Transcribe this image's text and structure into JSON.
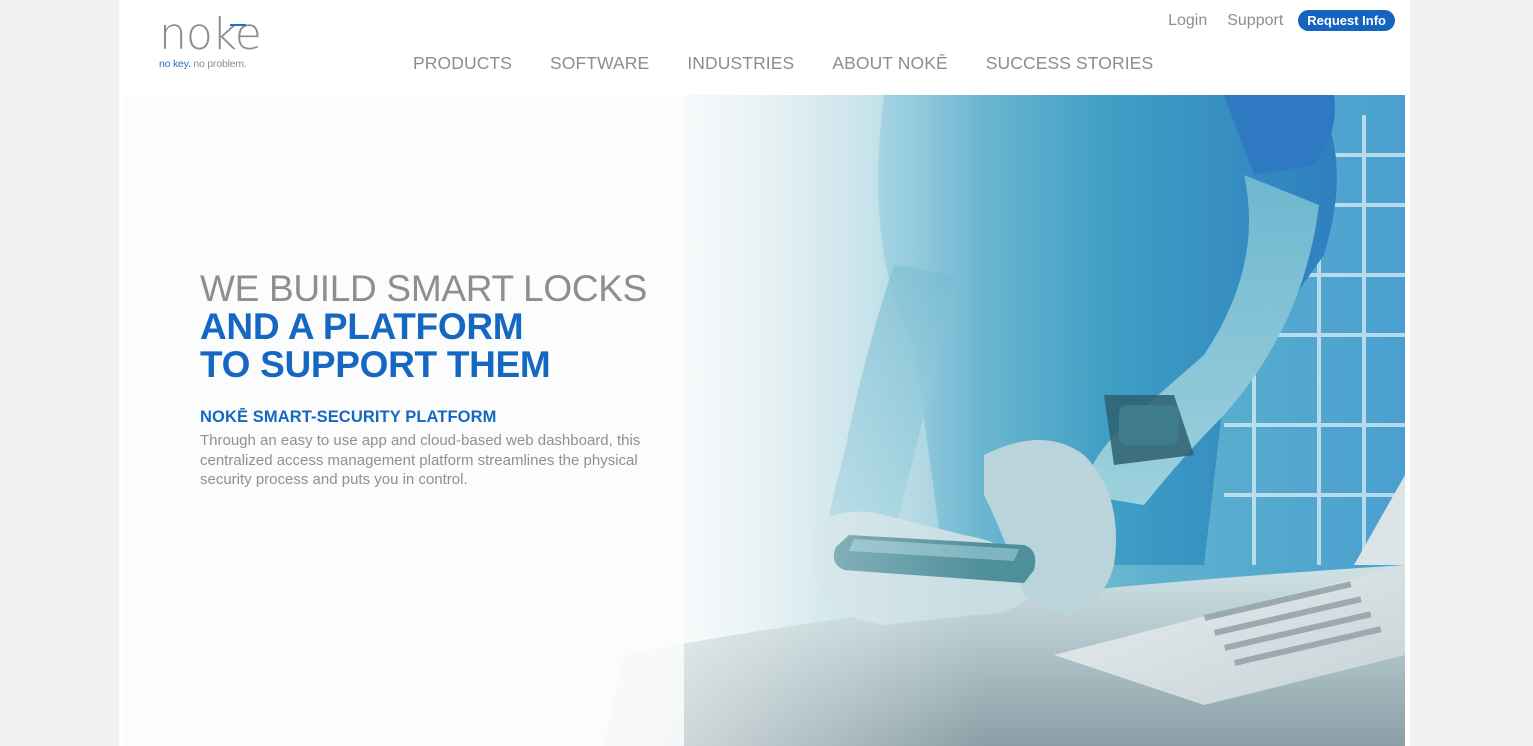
{
  "brand": {
    "logo_word": "nok",
    "logo_e": "e",
    "tagline_part1": "no key.",
    "tagline_part2": " no problem."
  },
  "utility_nav": {
    "login": "Login",
    "support": "Support",
    "request_info": "Request Info"
  },
  "main_nav": {
    "items": [
      "PRODUCTS",
      "SOFTWARE",
      "INDUSTRIES",
      "ABOUT NOKĒ",
      "SUCCESS STORIES"
    ]
  },
  "hero": {
    "headline_line1": "WE BUILD SMART LOCKS",
    "headline_line2": "AND A PLATFORM",
    "headline_line3": "TO SUPPORT THEM",
    "subhead": "NOKĒ SMART-SECURITY PLATFORM",
    "body": "Through an easy to use app and cloud-based web dashboard, this centralized access management platform streamlines the physical security process and puts you in control."
  },
  "colors": {
    "brand_blue": "#1568c2",
    "button_blue": "#1565c0",
    "gray_text": "#8a8d91",
    "page_background": "#f0f1f0"
  }
}
